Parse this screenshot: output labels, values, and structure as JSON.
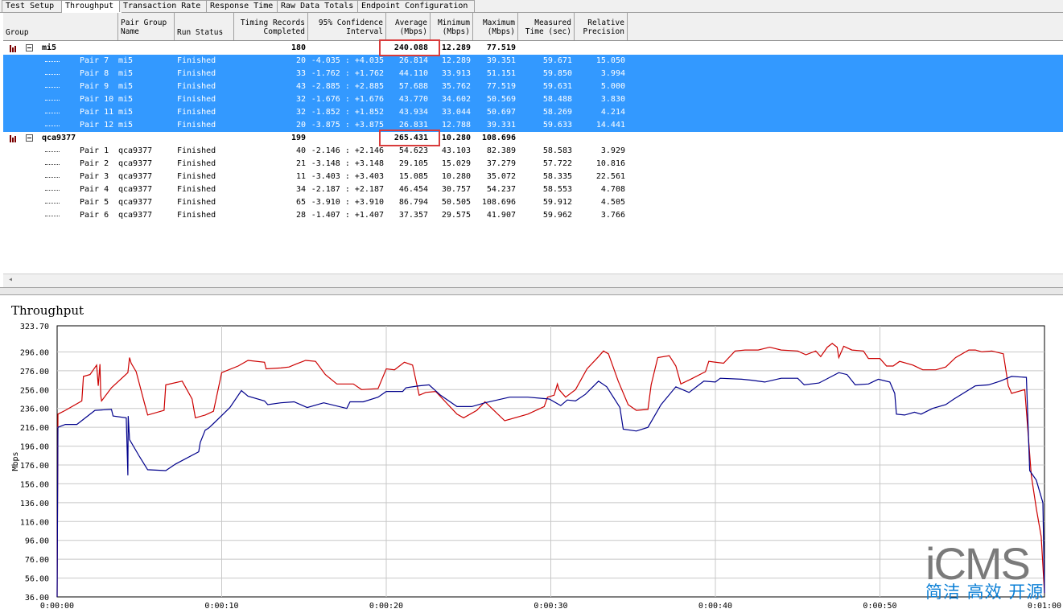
{
  "tabs": [
    "Test Setup",
    "Throughput",
    "Transaction Rate",
    "Response Time",
    "Raw Data Totals",
    "Endpoint Configuration"
  ],
  "active_tab": "Throughput",
  "columns": {
    "group": "Group",
    "pair_group_name": "Pair Group\nName",
    "run_status": "Run Status",
    "timing_records": "Timing Records\nCompleted",
    "confidence": "95% Confidence\nInterval",
    "average": "Average\n(Mbps)",
    "minimum": "Minimum\n(Mbps)",
    "maximum": "Maximum\n(Mbps)",
    "measured_time": "Measured\nTime (sec)",
    "relative_precision": "Relative\nPrecision"
  },
  "groups": [
    {
      "name": "mi5",
      "records": "180",
      "average": "240.088",
      "minimum": "12.289",
      "maximum": "77.519",
      "pairs": [
        {
          "pair": "Pair 7",
          "group": "mi5",
          "status": "Finished",
          "records": "20",
          "ci": "-4.035 : +4.035",
          "avg": "26.814",
          "min": "12.289",
          "max": "39.351",
          "time": "59.671",
          "prec": "15.050"
        },
        {
          "pair": "Pair 8",
          "group": "mi5",
          "status": "Finished",
          "records": "33",
          "ci": "-1.762 : +1.762",
          "avg": "44.110",
          "min": "33.913",
          "max": "51.151",
          "time": "59.850",
          "prec": "3.994"
        },
        {
          "pair": "Pair 9",
          "group": "mi5",
          "status": "Finished",
          "records": "43",
          "ci": "-2.885 : +2.885",
          "avg": "57.688",
          "min": "35.762",
          "max": "77.519",
          "time": "59.631",
          "prec": "5.000"
        },
        {
          "pair": "Pair 10",
          "group": "mi5",
          "status": "Finished",
          "records": "32",
          "ci": "-1.676 : +1.676",
          "avg": "43.770",
          "min": "34.602",
          "max": "50.569",
          "time": "58.488",
          "prec": "3.830"
        },
        {
          "pair": "Pair 11",
          "group": "mi5",
          "status": "Finished",
          "records": "32",
          "ci": "-1.852 : +1.852",
          "avg": "43.934",
          "min": "33.044",
          "max": "50.697",
          "time": "58.269",
          "prec": "4.214"
        },
        {
          "pair": "Pair 12",
          "group": "mi5",
          "status": "Finished",
          "records": "20",
          "ci": "-3.875 : +3.875",
          "avg": "26.831",
          "min": "12.788",
          "max": "39.331",
          "time": "59.633",
          "prec": "14.441"
        }
      ]
    },
    {
      "name": "qca9377",
      "records": "199",
      "average": "265.431",
      "minimum": "10.280",
      "maximum": "108.696",
      "pairs": [
        {
          "pair": "Pair 1",
          "group": "qca9377",
          "status": "Finished",
          "records": "40",
          "ci": "-2.146 : +2.146",
          "avg": "54.623",
          "min": "43.103",
          "max": "82.389",
          "time": "58.583",
          "prec": "3.929"
        },
        {
          "pair": "Pair 2",
          "group": "qca9377",
          "status": "Finished",
          "records": "21",
          "ci": "-3.148 : +3.148",
          "avg": "29.105",
          "min": "15.029",
          "max": "37.279",
          "time": "57.722",
          "prec": "10.816"
        },
        {
          "pair": "Pair 3",
          "group": "qca9377",
          "status": "Finished",
          "records": "11",
          "ci": "-3.403 : +3.403",
          "avg": "15.085",
          "min": "10.280",
          "max": "35.072",
          "time": "58.335",
          "prec": "22.561"
        },
        {
          "pair": "Pair 4",
          "group": "qca9377",
          "status": "Finished",
          "records": "34",
          "ci": "-2.187 : +2.187",
          "avg": "46.454",
          "min": "30.757",
          "max": "54.237",
          "time": "58.553",
          "prec": "4.708"
        },
        {
          "pair": "Pair 5",
          "group": "qca9377",
          "status": "Finished",
          "records": "65",
          "ci": "-3.910 : +3.910",
          "avg": "86.794",
          "min": "50.505",
          "max": "108.696",
          "time": "59.912",
          "prec": "4.505"
        },
        {
          "pair": "Pair 6",
          "group": "qca9377",
          "status": "Finished",
          "records": "28",
          "ci": "-1.407 : +1.407",
          "avg": "37.357",
          "min": "29.575",
          "max": "41.907",
          "time": "59.962",
          "prec": "3.766"
        }
      ]
    }
  ],
  "scroll_left_glyph": "◂",
  "watermark": {
    "logo": "iCMS",
    "tagline": "简洁 高效 开源"
  },
  "colors": {
    "selection": "#3399ff",
    "highlight_box": "#d83b3b",
    "series_red": "#cc0000",
    "series_blue": "#00008b"
  },
  "chart_data": {
    "type": "line",
    "title": "Throughput",
    "ylabel": "Mbps",
    "xlabel": "",
    "ylim": [
      36.0,
      323.7
    ],
    "xlim": [
      0,
      60
    ],
    "yticks": [
      "323.70",
      "296.00",
      "276.00",
      "256.00",
      "236.00",
      "216.00",
      "196.00",
      "176.00",
      "156.00",
      "136.00",
      "116.00",
      "96.00",
      "76.00",
      "56.00",
      "36.00"
    ],
    "ytick_values": [
      323.7,
      296,
      276,
      256,
      236,
      216,
      196,
      176,
      156,
      136,
      116,
      96,
      76,
      56,
      36
    ],
    "xticks": [
      "0:00:00",
      "0:00:10",
      "0:00:20",
      "0:00:30",
      "0:00:40",
      "0:00:50",
      "0:01:00"
    ],
    "xtick_values": [
      0,
      10,
      20,
      30,
      40,
      50,
      60
    ],
    "grid": true,
    "series": [
      {
        "color": "#cc0000",
        "points": [
          [
            0,
            36
          ],
          [
            0.05,
            230
          ],
          [
            0.5,
            234
          ],
          [
            1.5,
            244
          ],
          [
            1.6,
            270
          ],
          [
            2.0,
            272
          ],
          [
            2.4,
            282
          ],
          [
            2.5,
            260
          ],
          [
            2.6,
            283
          ],
          [
            2.65,
            250
          ],
          [
            2.7,
            244
          ],
          [
            3.3,
            258
          ],
          [
            4.3,
            274
          ],
          [
            4.4,
            290
          ],
          [
            4.5,
            284
          ],
          [
            4.8,
            275
          ],
          [
            5.3,
            242
          ],
          [
            5.5,
            229
          ],
          [
            6.5,
            234
          ],
          [
            6.6,
            261
          ],
          [
            7.6,
            265
          ],
          [
            8.2,
            246
          ],
          [
            8.4,
            226
          ],
          [
            9.0,
            229
          ],
          [
            9.5,
            233
          ],
          [
            10.0,
            274
          ],
          [
            11.0,
            281
          ],
          [
            11.6,
            287
          ],
          [
            12.6,
            285
          ],
          [
            12.7,
            278
          ],
          [
            13.6,
            279
          ],
          [
            14.1,
            280
          ],
          [
            14.5,
            283
          ],
          [
            15.1,
            287
          ],
          [
            15.7,
            286
          ],
          [
            16.3,
            272
          ],
          [
            17.0,
            262
          ],
          [
            18.0,
            262
          ],
          [
            18.5,
            256
          ],
          [
            19.5,
            257
          ],
          [
            20.0,
            278
          ],
          [
            20.5,
            277
          ],
          [
            21.1,
            285
          ],
          [
            21.6,
            282
          ],
          [
            22.0,
            250
          ],
          [
            22.4,
            253
          ],
          [
            23.0,
            254
          ],
          [
            24.3,
            230
          ],
          [
            24.7,
            226
          ],
          [
            25.5,
            234
          ],
          [
            26.0,
            243
          ],
          [
            27.2,
            223
          ],
          [
            28.6,
            230
          ],
          [
            29.6,
            238
          ],
          [
            29.8,
            248
          ],
          [
            30.2,
            250
          ],
          [
            30.4,
            262
          ],
          [
            30.5,
            256
          ],
          [
            30.9,
            248
          ],
          [
            31.5,
            256
          ],
          [
            32.2,
            278
          ],
          [
            32.9,
            291
          ],
          [
            33.2,
            297
          ],
          [
            33.5,
            294
          ],
          [
            34.1,
            265
          ],
          [
            34.7,
            240
          ],
          [
            35.2,
            234
          ],
          [
            35.9,
            235
          ],
          [
            36.1,
            261
          ],
          [
            36.5,
            290
          ],
          [
            37.2,
            292
          ],
          [
            37.6,
            281
          ],
          [
            37.9,
            262
          ],
          [
            38.5,
            267
          ],
          [
            39.4,
            275
          ],
          [
            39.6,
            286
          ],
          [
            40.5,
            284
          ],
          [
            41.2,
            297
          ],
          [
            41.8,
            298
          ],
          [
            42.6,
            298
          ],
          [
            43.3,
            301
          ],
          [
            44.0,
            298
          ],
          [
            45.0,
            297
          ],
          [
            45.5,
            293
          ],
          [
            46.1,
            297
          ],
          [
            46.4,
            291
          ],
          [
            46.8,
            301
          ],
          [
            47.1,
            305
          ],
          [
            47.4,
            301
          ],
          [
            47.5,
            290
          ],
          [
            47.8,
            302
          ],
          [
            48.3,
            298
          ],
          [
            49.0,
            297
          ],
          [
            49.3,
            289
          ],
          [
            50.0,
            289
          ],
          [
            50.4,
            281
          ],
          [
            50.8,
            281
          ],
          [
            51.2,
            286
          ],
          [
            52.0,
            282
          ],
          [
            52.6,
            277
          ],
          [
            53.4,
            277
          ],
          [
            54.0,
            280
          ],
          [
            54.6,
            290
          ],
          [
            55.4,
            298
          ],
          [
            55.8,
            298
          ],
          [
            56.2,
            296
          ],
          [
            56.8,
            297
          ],
          [
            57.5,
            294
          ],
          [
            57.8,
            260
          ],
          [
            58.0,
            252
          ],
          [
            58.8,
            256
          ],
          [
            59.2,
            165
          ],
          [
            59.5,
            130
          ],
          [
            59.8,
            100
          ],
          [
            60,
            40
          ]
        ]
      },
      {
        "color": "#00008b",
        "points": [
          [
            0,
            36
          ],
          [
            0.05,
            216
          ],
          [
            0.5,
            219
          ],
          [
            1.2,
            219
          ],
          [
            2.3,
            234
          ],
          [
            3.3,
            235
          ],
          [
            3.4,
            228
          ],
          [
            4.2,
            226
          ],
          [
            4.3,
            165
          ],
          [
            4.32,
            228
          ],
          [
            4.4,
            203
          ],
          [
            5.0,
            185
          ],
          [
            5.5,
            171
          ],
          [
            6.6,
            170
          ],
          [
            7.2,
            177
          ],
          [
            8.6,
            190
          ],
          [
            8.7,
            200
          ],
          [
            9.0,
            213
          ],
          [
            9.2,
            215
          ],
          [
            9.5,
            220
          ],
          [
            10.5,
            237
          ],
          [
            11.2,
            255
          ],
          [
            11.6,
            249
          ],
          [
            12.6,
            244
          ],
          [
            12.8,
            240
          ],
          [
            13.6,
            242
          ],
          [
            14.4,
            243
          ],
          [
            15.2,
            237
          ],
          [
            16.2,
            242
          ],
          [
            17.6,
            236
          ],
          [
            17.8,
            243
          ],
          [
            18.6,
            243
          ],
          [
            19.5,
            248
          ],
          [
            20.0,
            254
          ],
          [
            21.0,
            254
          ],
          [
            21.2,
            258
          ],
          [
            22.0,
            260
          ],
          [
            22.6,
            261
          ],
          [
            23.3,
            250
          ],
          [
            24.3,
            238
          ],
          [
            25.2,
            238
          ],
          [
            26.0,
            242
          ],
          [
            27.5,
            248
          ],
          [
            28.6,
            248
          ],
          [
            29.9,
            246
          ],
          [
            30.6,
            239
          ],
          [
            31.0,
            245
          ],
          [
            31.5,
            244
          ],
          [
            32.1,
            251
          ],
          [
            32.9,
            265
          ],
          [
            33.4,
            259
          ],
          [
            34.2,
            237
          ],
          [
            34.4,
            214
          ],
          [
            35.2,
            212
          ],
          [
            35.9,
            216
          ],
          [
            36.7,
            240
          ],
          [
            37.6,
            259
          ],
          [
            38.4,
            253
          ],
          [
            39.3,
            265
          ],
          [
            40.0,
            264
          ],
          [
            40.3,
            268
          ],
          [
            41.6,
            267
          ],
          [
            42.2,
            266
          ],
          [
            43.0,
            264
          ],
          [
            44.0,
            268
          ],
          [
            45.0,
            268
          ],
          [
            45.4,
            261
          ],
          [
            46.3,
            263
          ],
          [
            47.5,
            274
          ],
          [
            48.0,
            272
          ],
          [
            48.5,
            261
          ],
          [
            49.3,
            262
          ],
          [
            49.9,
            267
          ],
          [
            50.6,
            264
          ],
          [
            50.9,
            252
          ],
          [
            51.0,
            230
          ],
          [
            51.5,
            229
          ],
          [
            52.1,
            232
          ],
          [
            52.5,
            230
          ],
          [
            53.2,
            236
          ],
          [
            54.0,
            240
          ],
          [
            54.5,
            246
          ],
          [
            55.8,
            260
          ],
          [
            56.6,
            261
          ],
          [
            57.3,
            265
          ],
          [
            58.0,
            270
          ],
          [
            58.9,
            269
          ],
          [
            59.1,
            170
          ],
          [
            59.5,
            160
          ],
          [
            59.9,
            136
          ],
          [
            60,
            40
          ]
        ]
      }
    ]
  }
}
